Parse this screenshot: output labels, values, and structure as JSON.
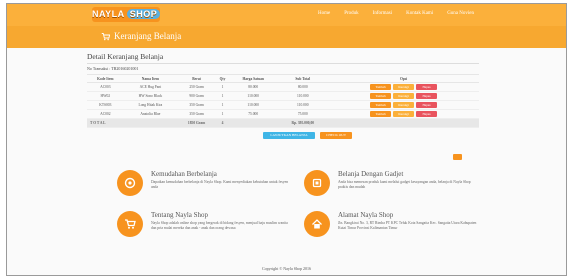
{
  "header": {
    "logo_a": "NAYLA",
    "logo_b": "SHOP",
    "nav": [
      "Home",
      "Produk",
      "Informasi",
      "Kontak Kami",
      "Guna Novien"
    ]
  },
  "banner": {
    "title": "Keranjang Belanja"
  },
  "main": {
    "title": "Detail Keranjang Belanja",
    "transaction": "No Transaksi : TR20160201001",
    "columns": [
      "Kode Item",
      "Nama Item",
      "Berat",
      "Qty",
      "Harga Satuan",
      "Sub Total",
      "Opsi"
    ],
    "rows": [
      [
        "AC003",
        "ACE Hug Pant",
        "250 Gram",
        "1",
        "80.000",
        "80.000"
      ],
      [
        "HW02",
        "HW Sono Black",
        "900 Gram",
        "1",
        "110.000",
        "110.000"
      ],
      [
        "KTS003",
        "Long Hitak Kira",
        "350 Gram",
        "1",
        "110.000",
        "110.000"
      ],
      [
        "AC002",
        "Anatolia Blue",
        "350 Gram",
        "1",
        "75.000",
        "75.000"
      ]
    ],
    "row_buttons": [
      "Tambah",
      "Kurangi",
      "Hapus"
    ],
    "total": {
      "label": "T O T A L",
      "weight": "1850 Gram",
      "qty": "4",
      "amount": "Rp. 395.000,00"
    },
    "continue_label": "LANJUTKAN BELANJA",
    "checkout_label": "CHECK OUT"
  },
  "features": [
    {
      "icon": "target-icon",
      "title": "Kemudahan Berbelanja",
      "desc": "Dapatkan kemudahan berbelanja di Nayla Shop. Kami menyediakan kebutuhan untuk fesyen anda"
    },
    {
      "icon": "phone-icon",
      "title": "Belanja Dengan Gadjet",
      "desc": "Anda bisa memesan produk kami melalui gadget kesayangan anda, belanja di Nayla Shop praktis dan mudah"
    },
    {
      "icon": "cart-icon",
      "title": "Tentang Nayla Shop",
      "desc": "Nayla Shop adalah online shop yang bergerak di bidang fesyen, menjual baju muslim wanita dan pria mulai mereka dan anak - anak dan orang dewasa"
    },
    {
      "icon": "home-icon",
      "title": "Alamat Nayla Shop",
      "desc": "Jln. Bangkirai No. 3, RT Rimba PT KPC Teluk Kota Sangatta Kec. Sangatta Utara Kabupaten Kutai Timur Provinsi Kalimantan Timur"
    }
  ],
  "footer": "Copyright © Nayla Shop 2016",
  "colors": {
    "accent": "#f7931e",
    "banner": "#f7a830",
    "blue": "#3fb5e6",
    "red": "#e9545e"
  }
}
